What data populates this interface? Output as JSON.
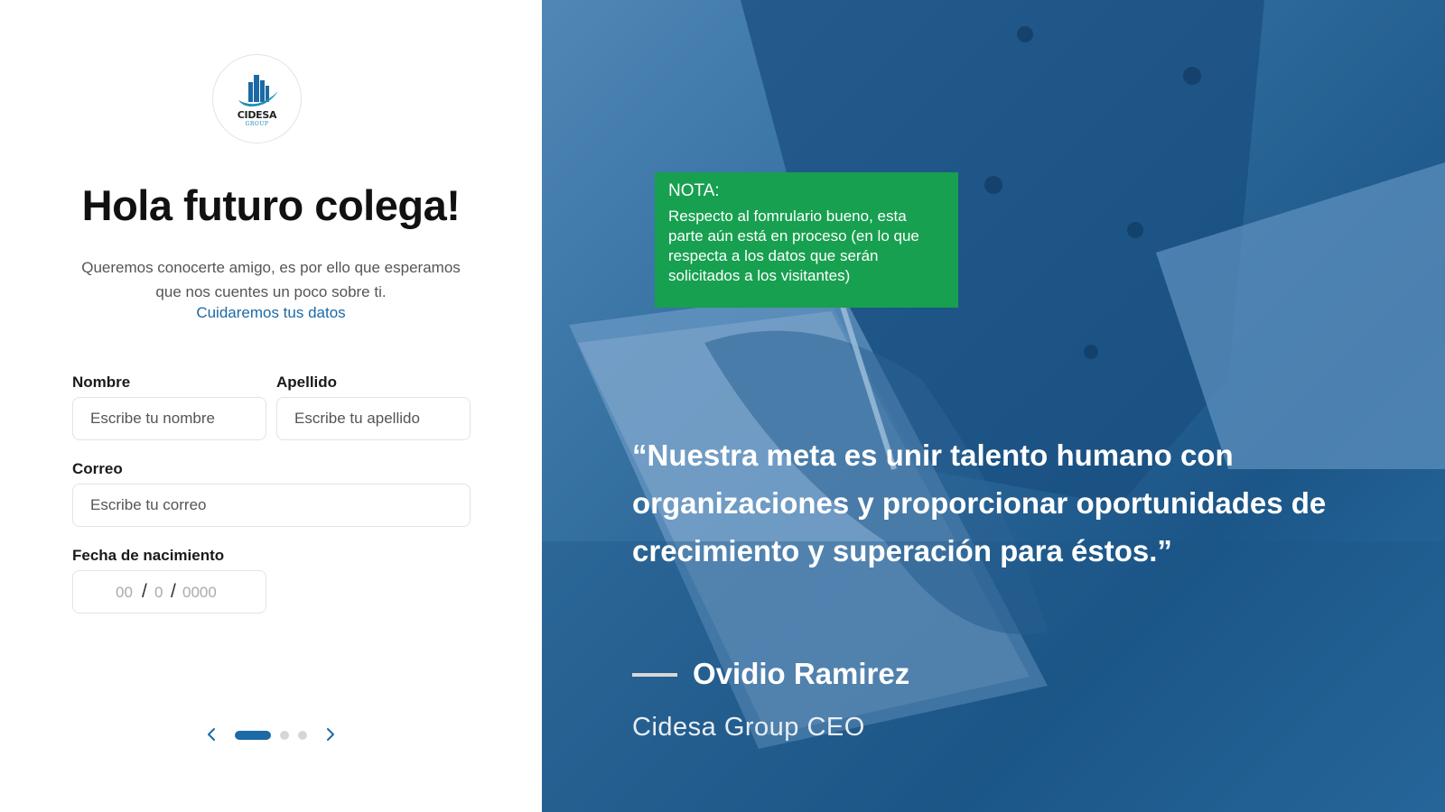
{
  "brand": {
    "name": "CIDESA",
    "sub": "GROUP",
    "logo_colors": {
      "building": "#1b6aa6",
      "swoosh": "#1f8fb5"
    }
  },
  "header": {
    "title": "Hola futuro colega!",
    "intro": "Queremos conocerte amigo, es por ello que esperamos que nos cuentes un poco sobre ti.",
    "privacy_link": "Cuidaremos tus datos"
  },
  "form": {
    "nombre": {
      "label": "Nombre",
      "placeholder": "Escribe tu nombre"
    },
    "apellido": {
      "label": "Apellido",
      "placeholder": "Escribe tu apellido"
    },
    "correo": {
      "label": "Correo",
      "placeholder": "Escribe tu correo"
    },
    "fecha": {
      "label": "Fecha de nacimiento",
      "day": "00",
      "month": "0",
      "year": "0000",
      "separator": "/"
    }
  },
  "pager": {
    "steps": 3,
    "current_step": 1,
    "prev_icon": "chevron-left-icon",
    "next_icon": "chevron-right-icon"
  },
  "note": {
    "heading": "NOTA:",
    "body": "Respecto al fomrulario bueno, esta parte aún está en proceso (en lo que respecta a los datos que serán solicitados a los visitantes)"
  },
  "testimonial": {
    "quote": "“Nuestra meta es unir talento humano con organizaciones y proporcionar oportunidades de crecimiento y superación para éstos.”",
    "author": "Ovidio Ramirez",
    "role": "Cidesa Group CEO"
  },
  "colors": {
    "accent": "#1b6aa6",
    "note_bg": "#17a050",
    "panel_overlay": "#2e6a9b"
  }
}
